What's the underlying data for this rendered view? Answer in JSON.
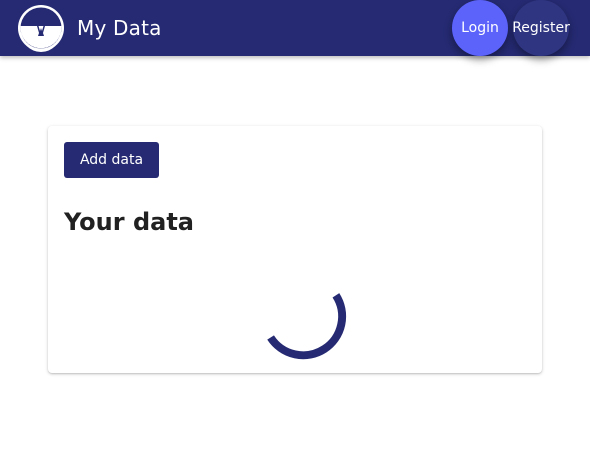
{
  "header": {
    "title": "My Data",
    "login_label": "Login",
    "register_label": "Register",
    "logo_icon": "tree-logo-icon"
  },
  "card": {
    "add_button_label": "Add data",
    "title": "Your data",
    "loading_icon": "loading-spinner-icon"
  },
  "colors": {
    "primary": "#252a72",
    "accent": "#5c63fb",
    "secondary_button": "#2f3580",
    "background": "#ffffff"
  }
}
